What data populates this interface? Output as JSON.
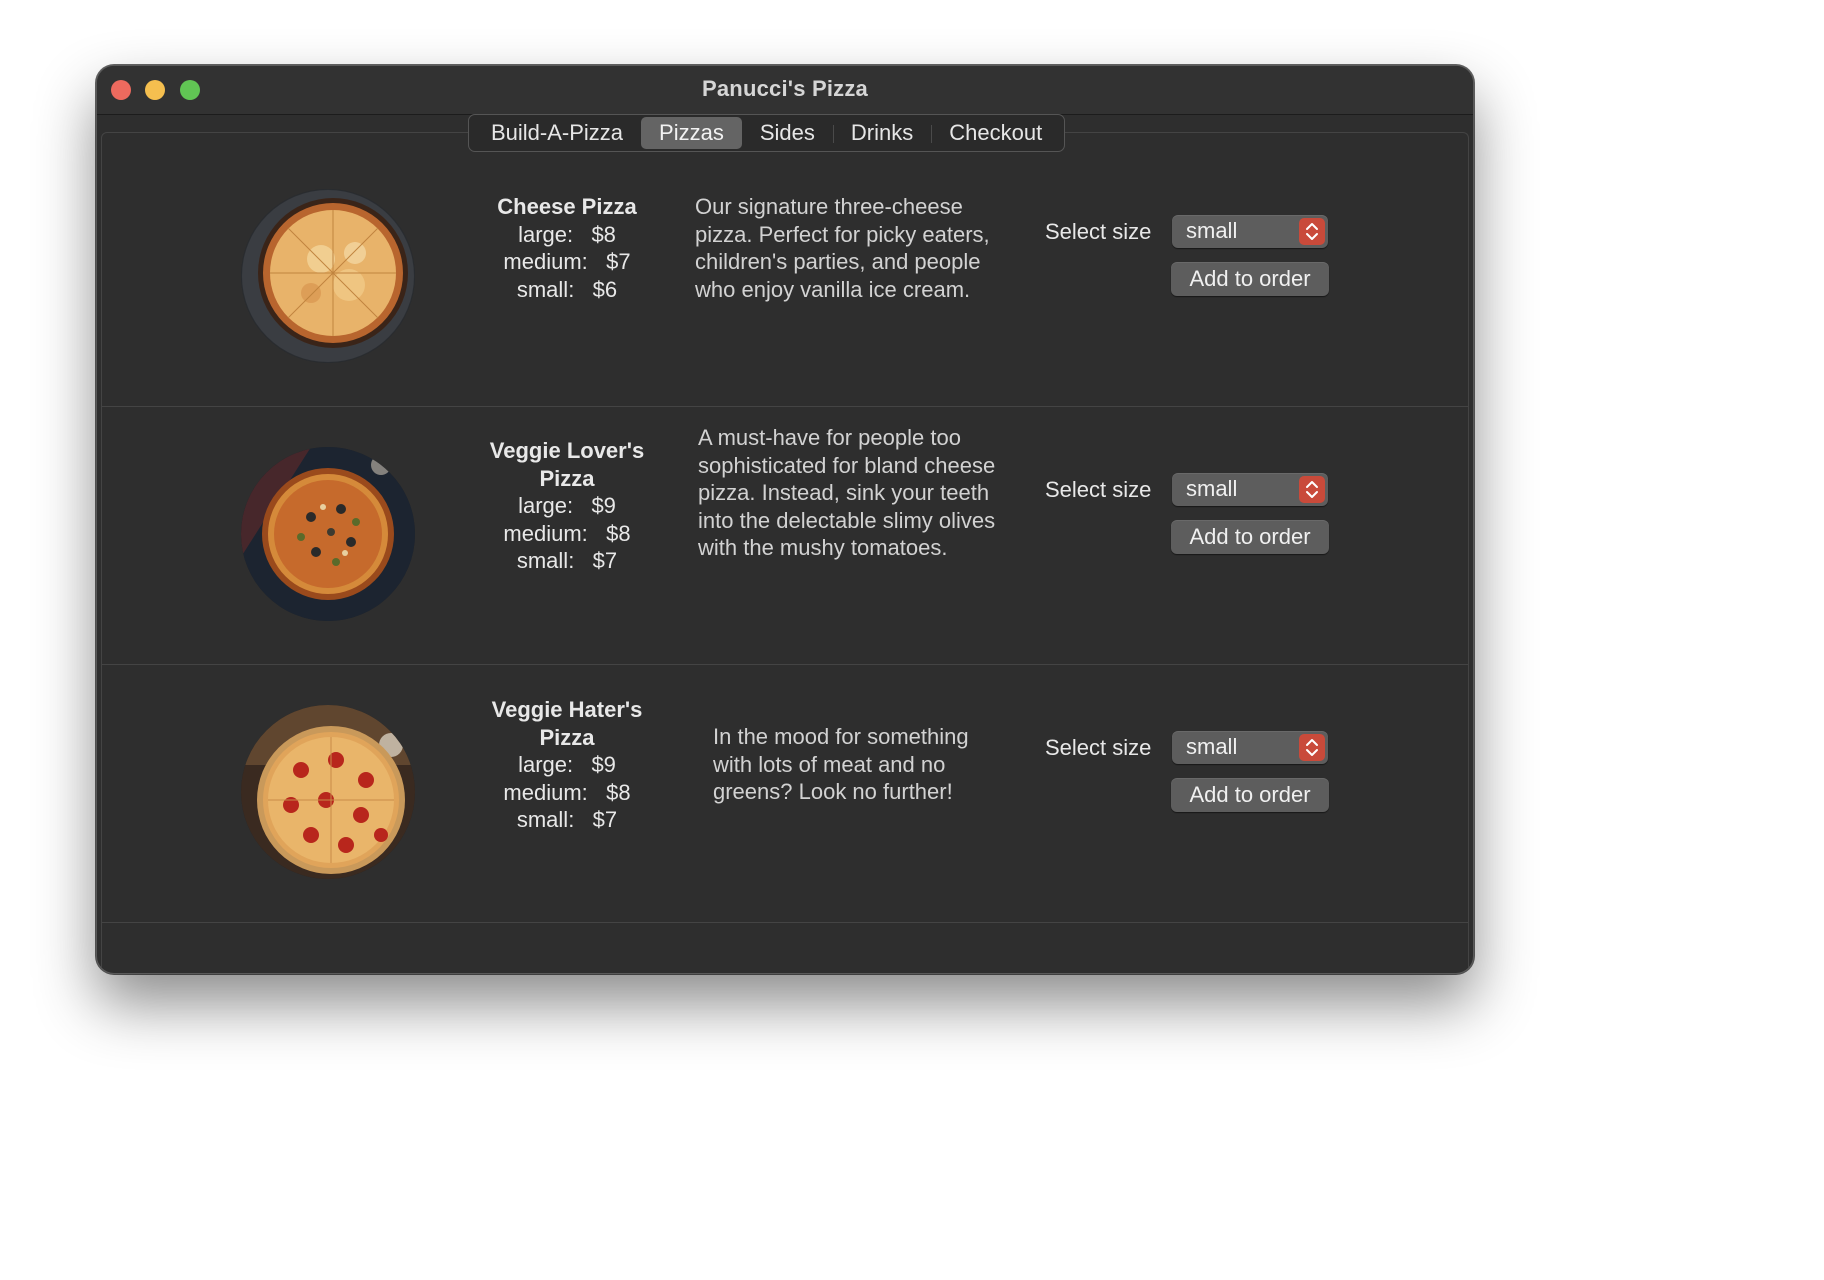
{
  "window": {
    "title": "Panucci's Pizza"
  },
  "tabs": [
    {
      "label": "Build-A-Pizza",
      "selected": false
    },
    {
      "label": "Pizzas",
      "selected": true
    },
    {
      "label": "Sides",
      "selected": false
    },
    {
      "label": "Drinks",
      "selected": false
    },
    {
      "label": "Checkout",
      "selected": false
    }
  ],
  "pizzas": [
    {
      "name": "Cheese Pizza",
      "prices": [
        "large:   $8",
        "medium:   $7",
        "small:   $6"
      ],
      "description": "Our signature three-cheese pizza. Perfect for picky eaters, children's parties, and people who enjoy vanilla ice cream.",
      "select_label": "Select size",
      "size_value": "small",
      "add_label": "Add to order"
    },
    {
      "name": "Veggie Lover's Pizza",
      "prices": [
        "large:   $9",
        "medium:   $8",
        "small:   $7"
      ],
      "description": "A must-have for people too sophisticated for bland cheese pizza. Instead, sink your teeth into the delectable slimy olives with the mushy tomatoes.",
      "select_label": "Select size",
      "size_value": "small",
      "add_label": "Add to order"
    },
    {
      "name": "Veggie Hater's Pizza",
      "prices": [
        "large:   $9",
        "medium:   $8",
        "small:   $7"
      ],
      "description": "In the mood for something with lots of meat and no greens? Look no further!",
      "select_label": "Select size",
      "size_value": "small",
      "add_label": "Add to order"
    }
  ],
  "colors": {
    "window_bg": "#2e2e2e",
    "control_bg": "#5d5d5d",
    "stepper_accent": "#c94a3a",
    "close": "#ed6a5e",
    "minimize": "#f5bf4f",
    "maximize": "#61c554"
  },
  "icons": {
    "window_controls": [
      "close-icon",
      "minimize-icon",
      "maximize-icon"
    ],
    "stepper": "chevron-up-down-icon"
  }
}
